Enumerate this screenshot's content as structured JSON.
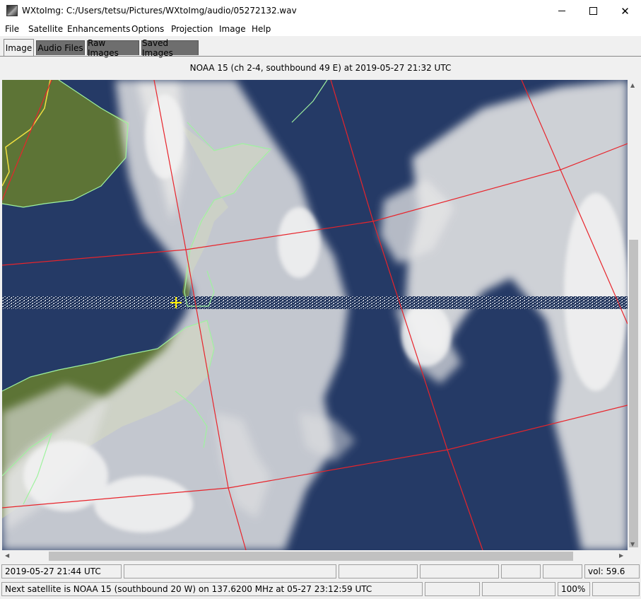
{
  "window": {
    "title": "WXtoImg: C:/Users/tetsu/Pictures/WXtoImg/audio/05272132.wav",
    "minimize_glyph": "",
    "close_glyph": "✕"
  },
  "menu": [
    "File",
    "Satellite",
    "Enhancements",
    "Options",
    "Projection",
    "Image",
    "Help"
  ],
  "tabs": [
    {
      "label": "Image",
      "active": true
    },
    {
      "label": "Audio Files",
      "active": false
    },
    {
      "label": "Raw Images",
      "active": false
    },
    {
      "label": "Saved Images",
      "active": false
    }
  ],
  "image": {
    "title": "NOAA 15 (ch 2-4, southbound 49 E) at 2019-05-27  21:32 UTC",
    "colors": {
      "ocean": "#253a66",
      "cloud": "#e6e6e6",
      "land": "#5d7436",
      "coastline": "#9ff29f",
      "grid": "#e8242b",
      "border": "#f0e040",
      "marker": "#ffee00"
    }
  },
  "status": {
    "time": "2019-05-27  21:44 UTC",
    "volume": "vol: 59.6",
    "next_satellite": "Next satellite is NOAA 15 (southbound 20 W) on 137.6200 MHz at 05-27 23:12:59 UTC",
    "zoom": "100%"
  },
  "icons": {
    "scroll_up": "▲",
    "scroll_down": "▼",
    "scroll_left": "◀",
    "scroll_right": "▶"
  }
}
